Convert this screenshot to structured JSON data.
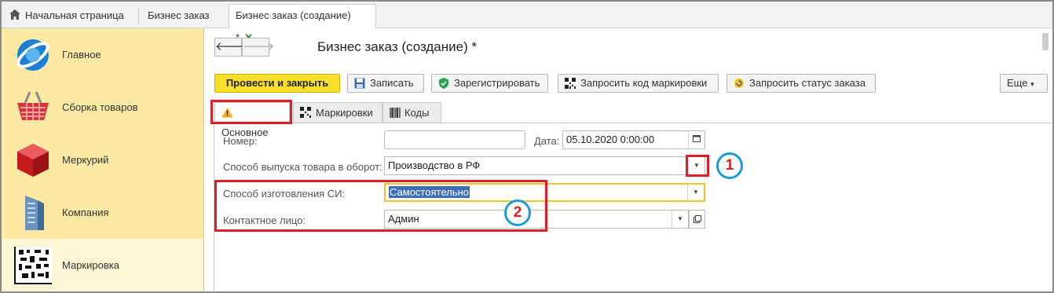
{
  "tabs": {
    "home": "Начальная страница",
    "tab2": "Бизнес заказ",
    "tab3": "Бизнес заказ (создание) *",
    "close": "✕"
  },
  "sidebar": {
    "items": [
      {
        "label": "Главное"
      },
      {
        "label": "Сборка товаров"
      },
      {
        "label": "Меркурий"
      },
      {
        "label": "Компания"
      },
      {
        "label": "Маркировка"
      }
    ]
  },
  "header": {
    "title": "Бизнес заказ (создание) *",
    "back": "🡐",
    "forward": "🡒"
  },
  "toolbar": {
    "post_close": "Провести и закрыть",
    "save": "Записать",
    "register": "Зарегистрировать",
    "request_code": "Запросить код маркировки",
    "request_status": "Запросить статус заказа",
    "more": "Еще",
    "more_arrow": "▾"
  },
  "form_tabs": {
    "main": "Основное",
    "markings": "Маркировки",
    "codes": "Коды"
  },
  "form": {
    "number_label": "Номер:",
    "number_value": "",
    "date_label": "Дата:",
    "date_value": "05.10.2020  0:00:00",
    "release_label": "Способ выпуска товара в оборот:",
    "release_value": "Производство в РФ",
    "method_label": "Способ изготовления СИ:",
    "method_value": "Самостоятельно",
    "contact_label": "Контактное лицо:",
    "contact_value": "Админ"
  },
  "annotations": {
    "one": "1",
    "two": "2"
  },
  "colors": {
    "accent_yellow": "#f8df2a",
    "sidebar_bg": "#fbe9a4",
    "annotation_red": "#e01e26",
    "annotation_blue": "#1e9bd7"
  }
}
